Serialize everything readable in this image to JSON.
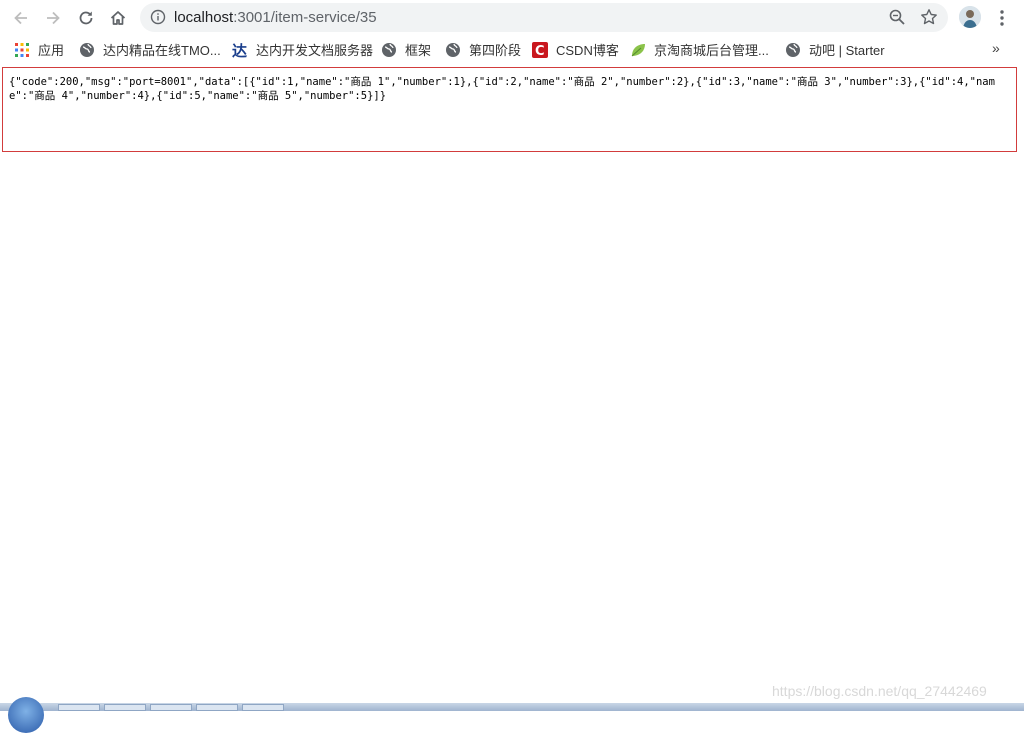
{
  "browser": {
    "url_host": "localhost",
    "url_path": ":3001/item-service/35",
    "icons": {
      "back": "back-arrow-icon",
      "forward": "forward-arrow-icon",
      "reload": "reload-icon",
      "home": "home-icon",
      "info": "info-icon",
      "zoom": "zoom-icon",
      "bookmark": "star-icon",
      "menu": "kebab-menu-icon"
    }
  },
  "bookmarks": {
    "items": [
      {
        "label": "应用",
        "icon": "apps-grid-icon"
      },
      {
        "label": "达内精品在线TMO...",
        "icon": "globe-icon"
      },
      {
        "label": "达内开发文档服务器",
        "icon": "tarena-logo-icon"
      },
      {
        "label": "框架",
        "icon": "globe-icon"
      },
      {
        "label": "第四阶段",
        "icon": "globe-icon"
      },
      {
        "label": "CSDN博客",
        "icon": "csdn-logo-icon"
      },
      {
        "label": "京淘商城后台管理...",
        "icon": "leaf-icon"
      },
      {
        "label": "动吧 | Starter",
        "icon": "globe-icon"
      }
    ],
    "more": "»"
  },
  "content": {
    "json_text": "{\"code\":200,\"msg\":\"port=8001\",\"data\":[{\"id\":1,\"name\":\"商品 1\",\"number\":1},{\"id\":2,\"name\":\"商品 2\",\"number\":2},{\"id\":3,\"name\":\"商品 3\",\"number\":3},{\"id\":4,\"name\":\"商品 4\",\"number\":4},{\"id\":5,\"name\":\"商品 5\",\"number\":5}]}"
  },
  "watermark": "https://blog.csdn.net/qq_27442469",
  "colors": {
    "content_border": "#d23c3c",
    "omnibox_bg": "#f1f3f4"
  }
}
